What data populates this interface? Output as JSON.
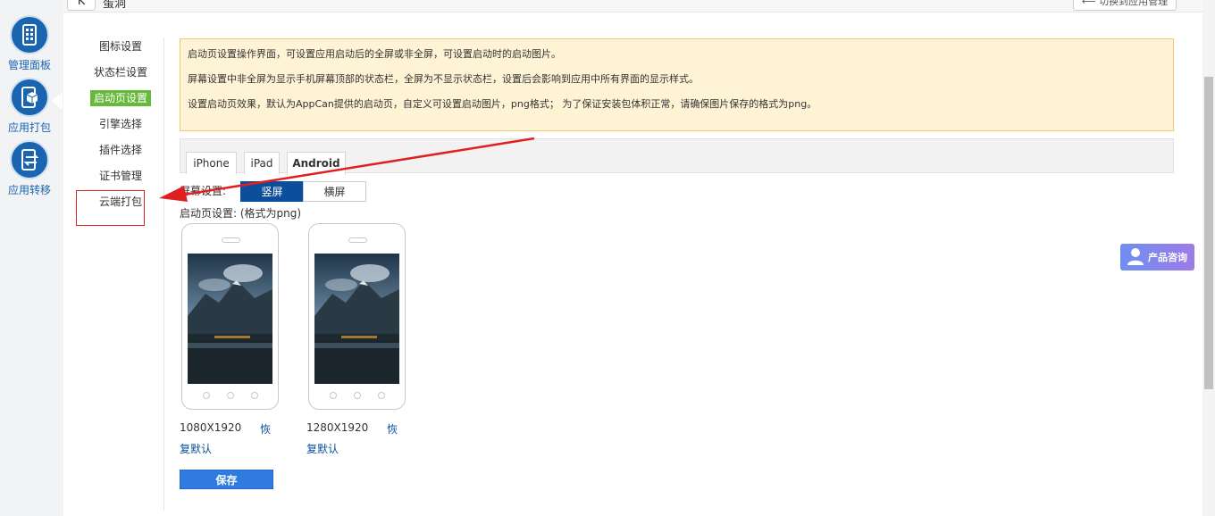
{
  "topbar": {
    "back_label": "K",
    "title": "蛋洞",
    "switch_label": "⟵ 切换到应用管理"
  },
  "rail": [
    {
      "label": "管理面板",
      "icon": "dashboard-icon"
    },
    {
      "label": "应用打包",
      "icon": "package-icon"
    },
    {
      "label": "应用转移",
      "icon": "transfer-icon"
    }
  ],
  "submenu": [
    {
      "label": "图标设置"
    },
    {
      "label": "状态栏设置"
    },
    {
      "label": "启动页设置"
    },
    {
      "label": "引擎选择"
    },
    {
      "label": "插件选择"
    },
    {
      "label": "证书管理"
    },
    {
      "label": "云端打包"
    }
  ],
  "notice": [
    "启动页设置操作界面，可设置应用启动后的全屏或非全屏，可设置启动时的启动图片。",
    "屏幕设置中非全屏为显示手机屏幕顶部的状态栏，全屏为不显示状态栏，设置后会影响到应用中所有界面的显示样式。",
    "设置启动页效果，默认为AppCan提供的启动页，自定义可设置启动图片，png格式； 为了保证安装包体积正常，请确保图片保存的格式为png。"
  ],
  "tabs": [
    {
      "label": "iPhone"
    },
    {
      "label": "iPad"
    },
    {
      "label": "Android"
    }
  ],
  "orientation": {
    "label": "屏幕设置:",
    "portrait": "竖屏",
    "landscape": "横屏"
  },
  "launch_label": "启动页设置: (格式为png)",
  "phones": [
    {
      "resolution": "1080X1920",
      "restore_1": "恢",
      "restore_2": "复默认"
    },
    {
      "resolution": "1280X1920",
      "restore_1": "恢",
      "restore_2": "复默认"
    }
  ],
  "save_label": "保存",
  "consult_label": "产品咨询",
  "colors": {
    "brand": "#1a64b0",
    "active_menu": "#67b93a",
    "portrait_bg": "#0b4f9c",
    "save_bg": "#2f7be0",
    "annotation": "#e02020"
  }
}
